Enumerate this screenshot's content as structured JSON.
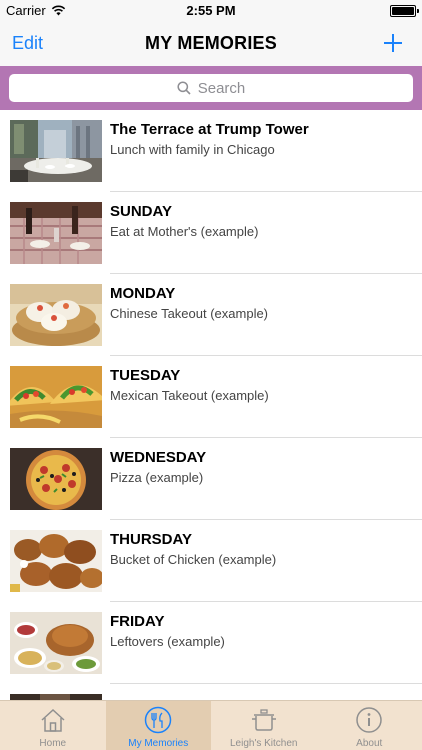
{
  "status_bar": {
    "carrier": "Carrier",
    "time": "2:55 PM"
  },
  "nav": {
    "edit_label": "Edit",
    "title": "MY MEMORIES"
  },
  "search": {
    "placeholder": "Search"
  },
  "colors": {
    "accent": "#1a82fb",
    "search_band": "#b376b3",
    "tab_bar": "#f2e2cf",
    "tab_active": "#e3cdb1"
  },
  "memories": [
    {
      "title": "The Terrace at Trump Tower",
      "subtitle": "Lunch with family in Chicago",
      "photo": "terrace-photo"
    },
    {
      "title": "SUNDAY",
      "subtitle": "Eat at Mother's (example)",
      "photo": "dining-table-photo"
    },
    {
      "title": "MONDAY",
      "subtitle": "Chinese Takeout (example)",
      "photo": "dim-sum-photo"
    },
    {
      "title": "TUESDAY",
      "subtitle": "Mexican Takeout (example)",
      "photo": "tacos-photo"
    },
    {
      "title": "WEDNESDAY",
      "subtitle": "Pizza (example)",
      "photo": "pizza-photo"
    },
    {
      "title": "THURSDAY",
      "subtitle": "Bucket of Chicken (example)",
      "photo": "fried-chicken-photo"
    },
    {
      "title": "FRIDAY",
      "subtitle": "Leftovers (example)",
      "photo": "leftovers-photo"
    }
  ],
  "tabs": [
    {
      "label": "Home",
      "icon": "home-icon",
      "active": false
    },
    {
      "label": "My Memories",
      "icon": "utensils-icon",
      "active": true
    },
    {
      "label": "Leigh's Kitchen",
      "icon": "pot-icon",
      "active": false
    },
    {
      "label": "About",
      "icon": "info-icon",
      "active": false
    }
  ]
}
